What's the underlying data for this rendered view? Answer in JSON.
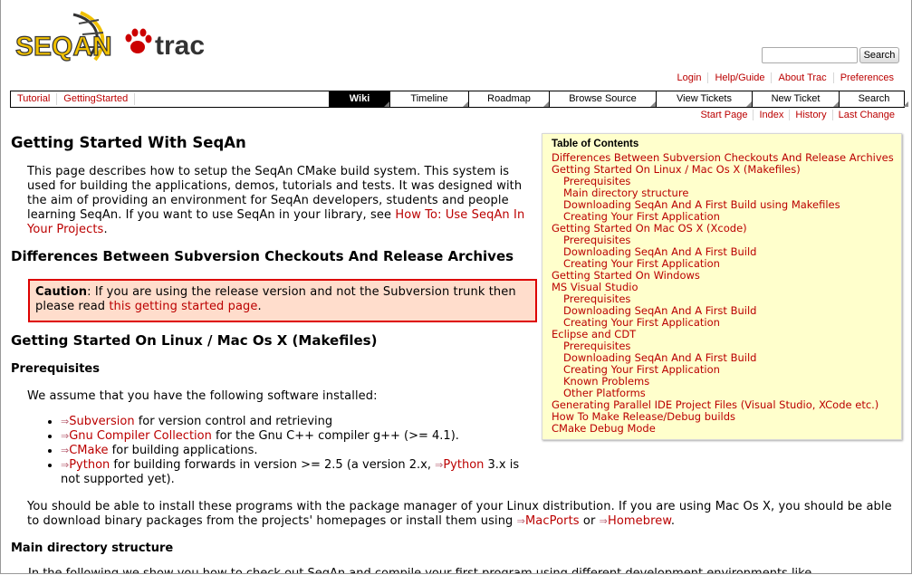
{
  "header": {
    "logo_text_left": "SEQAN",
    "logo_text_right": "trac",
    "search_placeholder": "",
    "search_button": "Search",
    "metanav": [
      "Login",
      "Help/Guide",
      "About Trac",
      "Preferences"
    ]
  },
  "nav": {
    "breadcrumbs": [
      "Tutorial",
      "GettingStarted"
    ],
    "tabs": [
      "Wiki",
      "Timeline",
      "Roadmap",
      "Browse Source",
      "View Tickets",
      "New Ticket",
      "Search"
    ],
    "active_tab": "Wiki",
    "ctxnav": [
      "Start Page",
      "Index",
      "History",
      "Last Change"
    ]
  },
  "page": {
    "title": "Getting Started With SeqAn",
    "intro": "This page describes how to setup the SeqAn CMake build system. This system is used for building the applications, demos, tutorials and tests. It was designed with the aim of providing an environment for SeqAn developers, students and people learning SeqAn. If you want to use SeqAn in your library, see ",
    "intro_link": "How To: Use SeqAn In Your Projects",
    "intro_end": ".",
    "h_diff": "Differences Between Subversion Checkouts And Release Archives",
    "caution_label": "Caution",
    "caution_text": ": If you are using the release version and not the Subversion trunk then please read ",
    "caution_link": "this getting started page",
    "caution_end": ".",
    "h_linux": "Getting Started On Linux / Mac Os X (Makefiles)",
    "h_prereq": "Prerequisites",
    "assume": "We assume that you have the following software installed:",
    "software": [
      {
        "link": "Subversion",
        "text": " for version control and retrieving"
      },
      {
        "link": "Gnu Compiler Collection",
        "text": " for the Gnu C++ compiler g++ (>= 4.1)."
      },
      {
        "link": "CMake",
        "text": " for building applications."
      },
      {
        "link": "Python",
        "text": " for building forwards in version >= 2.5 (a version 2.x, ",
        "link2": "Python",
        "text2": " 3.x is not supported yet)."
      }
    ],
    "pkg_text": "You should be able to install these programs with the package manager of your Linux distribution. If you are using Mac Os X, you should be able to download binary packages from the projects' homepages or install them using ",
    "pkg_link1": "MacPorts",
    "pkg_or": " or ",
    "pkg_link2": "Homebrew",
    "pkg_end": ".",
    "h_main_dir": "Main directory structure",
    "cut_line": "In the following we show you how to check out SeqAn and compile your first program using different development environments like"
  },
  "toc": {
    "title": "Table of Contents",
    "items": [
      {
        "label": "Differences Between Subversion Checkouts And Release Archives",
        "level": 1
      },
      {
        "label": "Getting Started On Linux / Mac Os X (Makefiles)",
        "level": 1
      },
      {
        "label": "Prerequisites",
        "level": 2
      },
      {
        "label": "Main directory structure",
        "level": 2
      },
      {
        "label": "Downloading SeqAn And A First Build using Makefiles",
        "level": 2
      },
      {
        "label": "Creating Your First Application",
        "level": 2
      },
      {
        "label": "Getting Started On Mac OS X (Xcode)",
        "level": 1
      },
      {
        "label": "Prerequisites",
        "level": 2
      },
      {
        "label": "Downloading SeqAn And A First Build",
        "level": 2
      },
      {
        "label": "Creating Your First Application",
        "level": 2
      },
      {
        "label": "Getting Started On Windows",
        "level": 1
      },
      {
        "label": "MS Visual Studio",
        "level": 1
      },
      {
        "label": "Prerequisites",
        "level": 2
      },
      {
        "label": "Downloading SeqAn And A First Build",
        "level": 2
      },
      {
        "label": "Creating Your First Application",
        "level": 2
      },
      {
        "label": "Eclipse and CDT",
        "level": 1
      },
      {
        "label": "Prerequisites",
        "level": 2
      },
      {
        "label": "Downloading SeqAn And A First Build",
        "level": 2
      },
      {
        "label": "Creating Your First Application",
        "level": 2
      },
      {
        "label": "Known Problems",
        "level": 2
      },
      {
        "label": "Other Platforms",
        "level": 2
      },
      {
        "label": "Generating Parallel IDE Project Files (Visual Studio, XCode etc.)",
        "level": 1
      },
      {
        "label": "How To Make Release/Debug builds",
        "level": 1
      },
      {
        "label": "CMake Debug Mode",
        "level": 1
      }
    ]
  },
  "colors": {
    "link": "#bb0000",
    "toc_bg": "#ffffcc",
    "caution_bg": "#ffddcc",
    "caution_border": "#dd0000",
    "active_tab": "#000000"
  }
}
